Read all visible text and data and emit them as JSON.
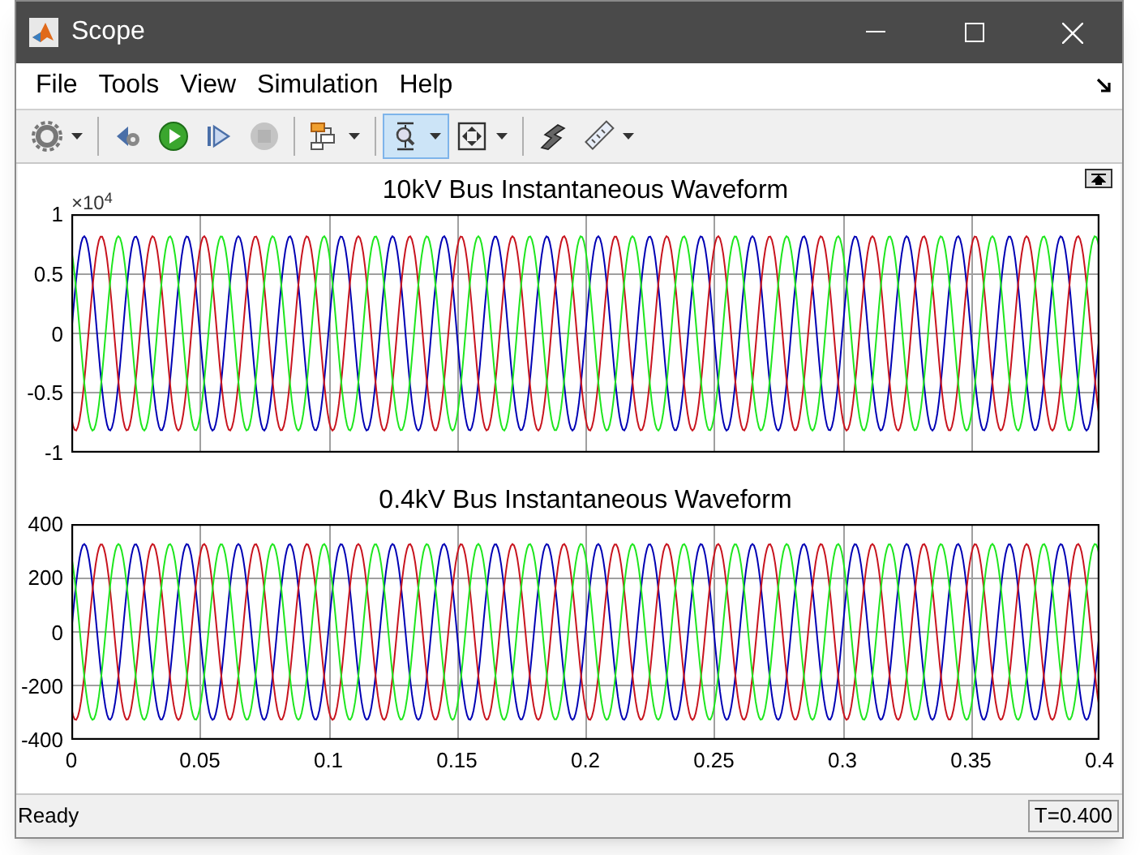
{
  "window": {
    "title": "Scope"
  },
  "menu": [
    {
      "label": "File"
    },
    {
      "label": "Tools"
    },
    {
      "label": "View"
    },
    {
      "label": "Simulation"
    },
    {
      "label": "Help"
    }
  ],
  "toolbar": [
    {
      "kind": "settings",
      "dropdown": true,
      "selected": false,
      "disabled": false
    },
    {
      "kind": "step-back",
      "dropdown": false,
      "selected": false,
      "disabled": false
    },
    {
      "kind": "run",
      "dropdown": false,
      "selected": false,
      "disabled": false
    },
    {
      "kind": "step-forward",
      "dropdown": false,
      "selected": false,
      "disabled": false
    },
    {
      "kind": "stop",
      "dropdown": false,
      "selected": false,
      "disabled": true
    },
    {
      "kind": "signals",
      "dropdown": true,
      "selected": false,
      "disabled": false
    },
    {
      "kind": "zoom",
      "dropdown": true,
      "selected": true,
      "disabled": false
    },
    {
      "kind": "fit",
      "dropdown": true,
      "selected": false,
      "disabled": false
    },
    {
      "kind": "highlight",
      "dropdown": false,
      "selected": false,
      "disabled": false
    },
    {
      "kind": "measure",
      "dropdown": true,
      "selected": false,
      "disabled": false
    }
  ],
  "plots": [
    {
      "title": "10kV Bus Instantaneous Waveform",
      "scale_label": "×10$^{4}$",
      "yticks": [
        "1",
        "0.5",
        "0",
        "-0.5",
        "-1"
      ],
      "traces": [
        {
          "color": "#0000b4"
        },
        {
          "color": "#c8141e"
        },
        {
          "color": "#1ee61e"
        }
      ]
    },
    {
      "title": "0.4kV Bus Instantaneous Waveform",
      "yticks": [
        "400",
        "200",
        "0",
        "-200",
        "-400"
      ],
      "xticks": [
        "0",
        "0.05",
        "0.1",
        "0.15",
        "0.2",
        "0.25",
        "0.3",
        "0.35",
        "0.4"
      ],
      "traces": [
        {
          "color": "#0000b4"
        },
        {
          "color": "#c8141e"
        },
        {
          "color": "#1ee61e"
        }
      ]
    }
  ],
  "status_bar": {
    "text": "Ready",
    "time": "T=0.400"
  }
}
